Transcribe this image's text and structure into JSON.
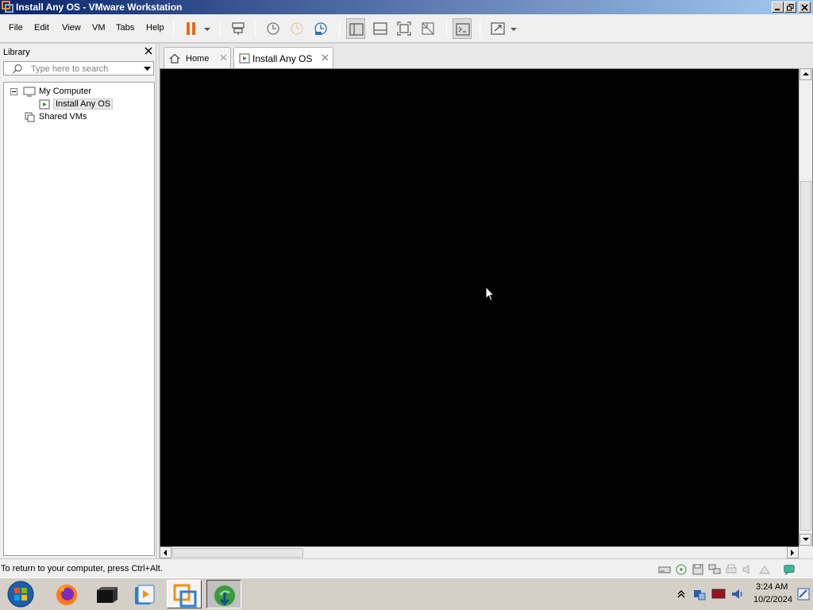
{
  "window": {
    "title": "Install Any OS - VMware Workstation"
  },
  "menu": {
    "items": [
      "File",
      "Edit",
      "View",
      "VM",
      "Tabs",
      "Help"
    ]
  },
  "library": {
    "title": "Library",
    "search_placeholder": "Type here to search",
    "tree": {
      "my_computer": "My Computer",
      "vm": "Install Any OS",
      "shared": "Shared VMs"
    }
  },
  "tabs": [
    {
      "label": "Home",
      "active": false
    },
    {
      "label": "Install Any OS",
      "active": true
    }
  ],
  "statusbar": {
    "text": "To return to your computer, press Ctrl+Alt."
  },
  "taskbar": {
    "time": "3:24 AM",
    "date": "10/2/2024"
  },
  "colors": {
    "titlebar_start": "#0a246a",
    "titlebar_end": "#a6caf0",
    "pause_accent": "#e86a1a",
    "console_bg": "#000000"
  }
}
